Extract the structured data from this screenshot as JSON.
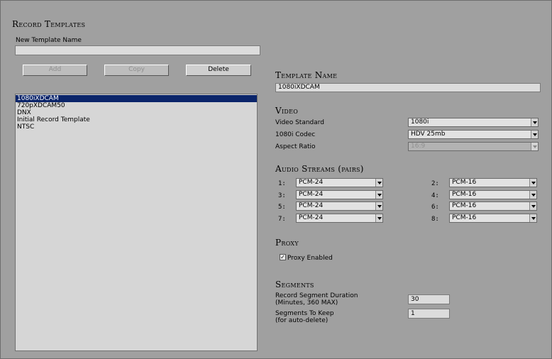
{
  "left": {
    "title": "Record Templates",
    "new_template_label": "New Template Name",
    "new_template_value": "",
    "buttons": {
      "add": "Add",
      "copy": "Copy",
      "delete": "Delete"
    },
    "templates": [
      "1080iXDCAM",
      "720pXDCAM50",
      "DNX",
      "Initial Record Template",
      "NTSC"
    ],
    "selected_index": 0
  },
  "template_name": {
    "title": "Template Name",
    "value": "1080iXDCAM"
  },
  "video": {
    "title": "Video",
    "standard_label": "Video Standard",
    "standard_value": "1080i",
    "codec_label": "1080i Codec",
    "codec_value": "HDV 25mb",
    "aspect_label": "Aspect Ratio",
    "aspect_value": "16:9"
  },
  "audio": {
    "title": "Audio Streams (pairs)",
    "streams": [
      {
        "label": "1:",
        "value": "PCM-24"
      },
      {
        "label": "2:",
        "value": "PCM-16"
      },
      {
        "label": "3:",
        "value": "PCM-24"
      },
      {
        "label": "4:",
        "value": "PCM-16"
      },
      {
        "label": "5:",
        "value": "PCM-24"
      },
      {
        "label": "6:",
        "value": "PCM-16"
      },
      {
        "label": "7:",
        "value": "PCM-24"
      },
      {
        "label": "8:",
        "value": "PCM-16"
      }
    ]
  },
  "proxy": {
    "title": "Proxy",
    "enabled_label": "Proxy Enabled",
    "checkmark": "✓"
  },
  "segments": {
    "title": "Segments",
    "duration_label_1": "Record Segment Duration",
    "duration_label_2": "(Minutes, 360 MAX)",
    "duration_value": "30",
    "keep_label_1": "Segments To Keep",
    "keep_label_2": "(for auto-delete)",
    "keep_value": "1"
  }
}
